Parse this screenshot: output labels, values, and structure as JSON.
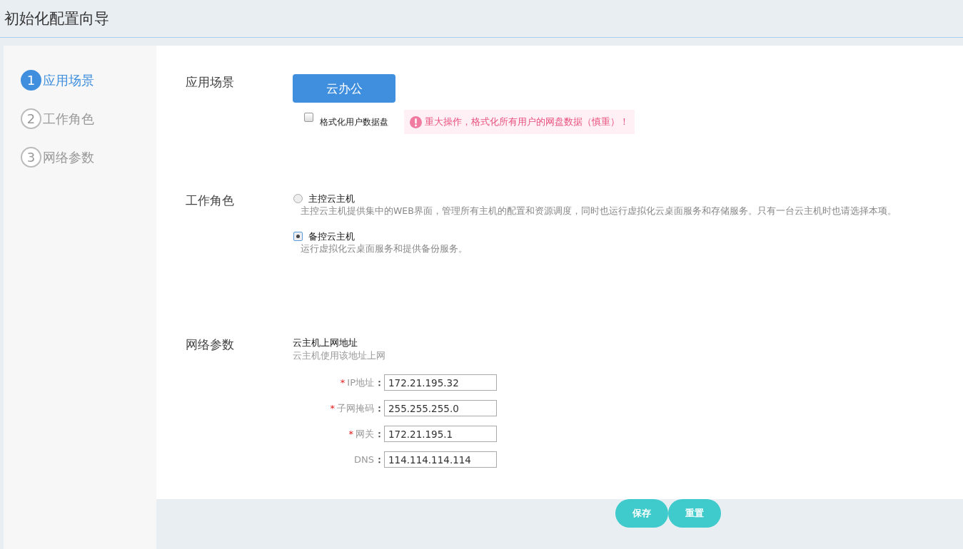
{
  "header": {
    "title": "初始化配置向导"
  },
  "steps": [
    {
      "number": "1",
      "label": "应用场景",
      "selected": true
    },
    {
      "number": "2",
      "label": "工作角色",
      "selected": false
    },
    {
      "number": "3",
      "label": "网络参数",
      "selected": false
    }
  ],
  "scene": {
    "label": "应用场景",
    "button": "云办公",
    "format_checkbox": {
      "label": "格式化用户数据盘",
      "checked": false
    },
    "warning": "重大操作，格式化所有用户的网盘数据（慎重）！"
  },
  "role": {
    "label": "工作角色",
    "options": [
      {
        "title": "主控云主机",
        "description": "主控云主机提供集中的WEB界面，管理所有主机的配置和资源调度，同时也运行虚拟化云桌面服务和存储服务。只有一台云主机时也请选择本项。",
        "selected": false
      },
      {
        "title": "备控云主机",
        "description": "运行虚拟化云桌面服务和提供备份服务。",
        "selected": true
      }
    ]
  },
  "network": {
    "label": "网络参数",
    "title": "云主机上网地址",
    "subtitle": "云主机使用该地址上网",
    "fields": [
      {
        "marker": "*",
        "label": "IP地址",
        "colon": "：",
        "value": "172.21.195.32"
      },
      {
        "marker": "*",
        "label": "子网掩码",
        "colon": "：",
        "value": "255.255.255.0"
      },
      {
        "marker": "*",
        "label": "网关",
        "colon": "：",
        "value": "172.21.195.1"
      },
      {
        "label": "DNS",
        "colon": "：",
        "value": "114.114.114.114"
      }
    ]
  },
  "buttons": [
    "保存",
    "重置"
  ]
}
